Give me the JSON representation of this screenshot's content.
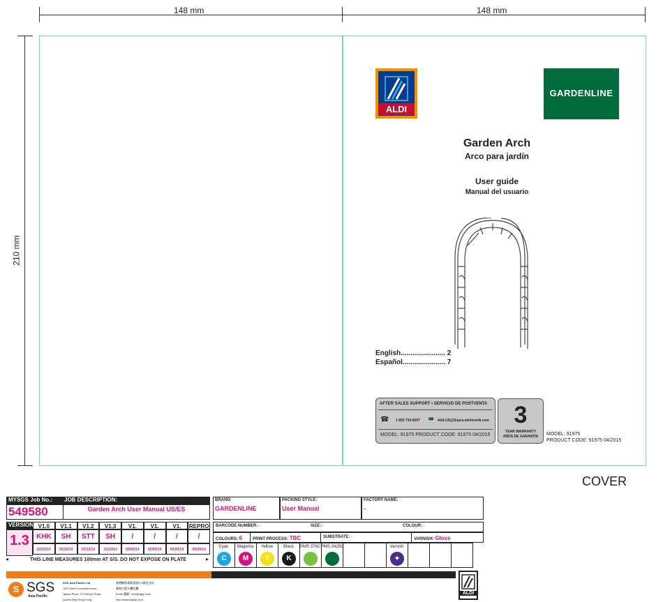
{
  "dimensions": {
    "width_left": "148 mm",
    "width_right": "148 mm",
    "height": "210 mm"
  },
  "cover": {
    "aldi_logo_text": "ALDI",
    "gardenline_logo_text": "GARDENLINE",
    "title_en": "Garden Arch",
    "title_es": "Arco para jardín",
    "guide_en": "User guide",
    "guide_es": "Manual del usuario",
    "toc": [
      "English....................... 2",
      "Español...................... 7"
    ],
    "support_header": "AFTER SALES SUPPORT • SERVICIO DE POSTVENTA",
    "phone": "1 855 734 8297",
    "email": "Aldi-US@Supra-elektronik.com",
    "support_footer": "MODEL: 91975    PRODUCT CODE: 91975    04/2015",
    "warranty_number": "3",
    "warranty_en": "YEAR WARRANTY",
    "warranty_es": "AÑOS DE GARANTÍA",
    "model_line": "MODEL: 91975",
    "product_code_line": "PRODUCT CODE: 91975    04/2015",
    "cover_label": "COVER"
  },
  "job": {
    "job_no_label": "MYSGS Job No.:",
    "job_no": "549580",
    "job_desc_label": "JOB DESCRIPTION:",
    "job_desc": "Garden Arch User Manual US/ES",
    "brand_label": "BRAND:",
    "brand": "GARDENLINE",
    "packing_label": "PACKING STYLE:",
    "packing": "User Manual",
    "factory_label": "FACTORY NAME:",
    "factory": "-",
    "version_label": "VERSION",
    "version": "1.3",
    "versions": [
      {
        "name": "V1.0",
        "initials": "KHK",
        "date": "03/10/14"
      },
      {
        "name": "V1.1",
        "initials": "SH",
        "date": "20/10/14"
      },
      {
        "name": "V1.2",
        "initials": "STT",
        "date": "22/10/14"
      },
      {
        "name": "V1.3",
        "initials": "SH",
        "date": "31/10/14"
      },
      {
        "name": "V1.",
        "initials": "/",
        "date": "00/00/14"
      },
      {
        "name": "V1.",
        "initials": "/",
        "date": "00/00/14"
      },
      {
        "name": "V1.",
        "initials": "/",
        "date": "00/00/14"
      },
      {
        "name": "REPRO",
        "initials": "/",
        "date": "00/00/14"
      }
    ],
    "measure_note": "THIS LINE MEASURES 100mm AT S/S. DO NOT EXPOSE ON PLATE",
    "barcode_label": "BARCODE NUMBER:",
    "barcode": "-",
    "size_label": "SIZE:",
    "size": "-",
    "colour_label": "COLOUR:",
    "colour": "-",
    "colours_label": "COLOURS:",
    "colours": "6",
    "print_label": "PRINT PROCESS:",
    "print_process": "TBC",
    "substrate_label": "SUBSTRATE:",
    "substrate": "-",
    "varnish_label": "VARNISH:",
    "varnish": "Gloss",
    "inks": [
      {
        "name": "Cyan",
        "letter": "C",
        "color": "#1aa6e0"
      },
      {
        "name": "Magenta",
        "letter": "M",
        "color": "#d4137a"
      },
      {
        "name": "Yellow",
        "letter": "Y",
        "color": "#f5e11a"
      },
      {
        "name": "Black",
        "letter": "K",
        "color": "#1a1a1a"
      },
      {
        "name": "PMS 376C",
        "letter": "",
        "color": "#7ac143"
      },
      {
        "name": "PMS 3425C",
        "letter": "",
        "color": "#006c3b"
      }
    ],
    "varnish_ink_label": "Varnish"
  },
  "sgs": {
    "logo": "SGS",
    "sub": "Asia Pacific",
    "address": [
      "SGS Asia Pacific Ltd",
      "15/F North Cornwall House,",
      "Taikoo Place, 979 King's Road,",
      "Quarry Bay Hong Kong"
    ],
    "chinese": [
      "香港鰂魚涌英皇道979號太古坊",
      "康和大廈15樓北翼",
      "Email 電郵 : info@sgap.com",
      "http://www.sgsap.com"
    ],
    "aldi_small": "ALDI"
  },
  "colors": {
    "gardenline_green": "#006c3b",
    "aldi_blue": "#0a3a8c",
    "aldi_orange": "#f39200",
    "trim_cyan": "#6fd0dc",
    "magenta_text": "#d4137a"
  }
}
